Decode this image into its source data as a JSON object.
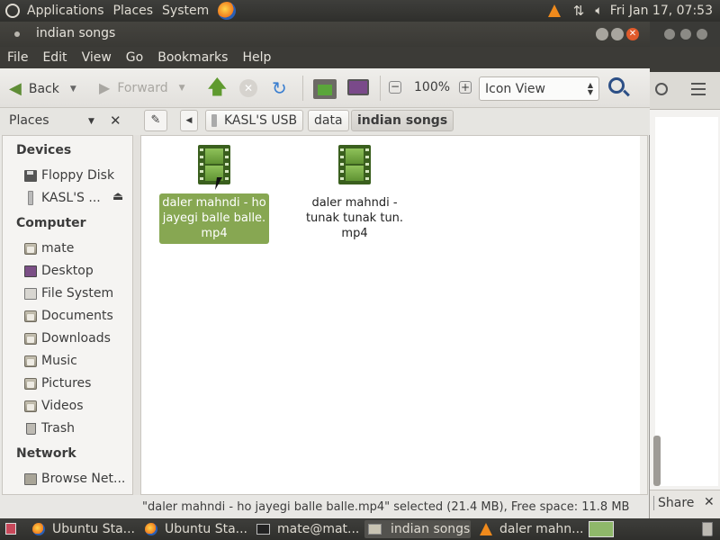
{
  "top_panel": {
    "menus": [
      "Applications",
      "Places",
      "System"
    ],
    "clock": "Fri Jan 17, 07:53"
  },
  "window": {
    "title": "indian songs",
    "menu": [
      "File",
      "Edit",
      "View",
      "Go",
      "Bookmarks",
      "Help"
    ]
  },
  "toolbar": {
    "back": "Back",
    "forward": "Forward",
    "zoom": "100%",
    "view_mode": "Icon View"
  },
  "location": {
    "places_label": "Places",
    "breadcrumbs": [
      "KASL'S USB",
      "data",
      "indian songs"
    ]
  },
  "sidebar": {
    "sections": [
      {
        "heading": "Devices",
        "items": [
          "Floppy Disk",
          "KASL'S ..."
        ]
      },
      {
        "heading": "Computer",
        "items": [
          "mate",
          "Desktop",
          "File System",
          "Documents",
          "Downloads",
          "Music",
          "Pictures",
          "Videos",
          "Trash"
        ]
      },
      {
        "heading": "Network",
        "items": [
          "Browse Net..."
        ]
      }
    ]
  },
  "files": [
    {
      "lines": [
        "daler mahndi - ho",
        "jayegi balle balle.",
        "mp4"
      ],
      "selected": true
    },
    {
      "lines": [
        "daler mahndi -",
        "tunak tunak tun.",
        "mp4"
      ],
      "selected": false
    }
  ],
  "status": "\"daler mahndi - ho jayegi balle balle.mp4\" selected (21.4 MB), Free space: 11.8 MB",
  "background_window": {
    "share_label": "Share"
  },
  "taskbar": [
    {
      "label": "Ubuntu Sta...",
      "icon": "firefox-icon",
      "active": false
    },
    {
      "label": "Ubuntu Sta...",
      "icon": "firefox-icon",
      "active": false
    },
    {
      "label": "mate@mat...",
      "icon": "terminal-icon",
      "active": false
    },
    {
      "label": "indian songs",
      "icon": "folder-icon",
      "active": true
    },
    {
      "label": "daler mahn...",
      "icon": "vlc-icon",
      "active": false
    }
  ],
  "colors": {
    "selection": "#87a752",
    "panel": "#3c3b37",
    "close_button": "#e05a2b"
  }
}
